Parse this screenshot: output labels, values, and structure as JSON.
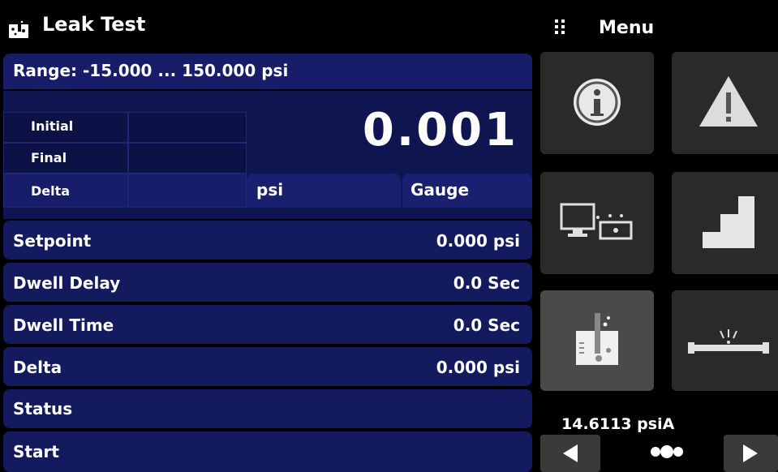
{
  "header": {
    "title": "Leak Test",
    "menu_label": "Menu"
  },
  "range": {
    "text": "Range: -15.000 ... 150.000 psi"
  },
  "display": {
    "value": "0.001",
    "unit": "psi",
    "mode": "Gauge",
    "grid_labels": [
      "Initial",
      "Final",
      "Delta"
    ]
  },
  "rows": [
    {
      "label": "Setpoint",
      "value": "0.000 psi"
    },
    {
      "label": "Dwell Delay",
      "value": "0.0 Sec"
    },
    {
      "label": "Dwell Time",
      "value": "0.0 Sec"
    },
    {
      "label": "Delta",
      "value": "0.000 psi"
    },
    {
      "label": "Status",
      "value": ""
    },
    {
      "label": "Start",
      "value": ""
    }
  ],
  "menu_tiles": [
    {
      "icon": "info-icon"
    },
    {
      "icon": "warning-icon"
    },
    {
      "icon": "remote-communication-icon"
    },
    {
      "icon": "step-program-icon"
    },
    {
      "icon": "leak-test-icon",
      "active": true
    },
    {
      "icon": "burst-test-icon"
    }
  ],
  "barometer": {
    "reading": "14.6113 psiA"
  },
  "colors": {
    "panel": "#101656",
    "row": "#141a5e",
    "tile": "#2a2a2a",
    "tile_active": "#4a4a4a"
  }
}
